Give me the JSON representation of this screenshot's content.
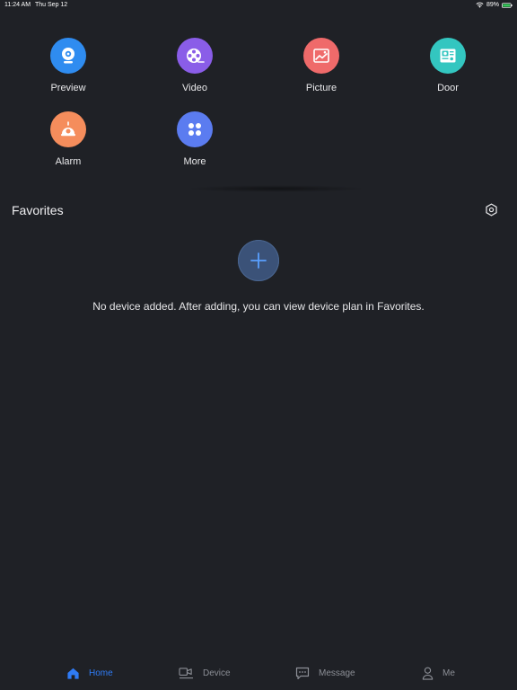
{
  "status_bar": {
    "time": "11:24 AM",
    "date": "Thu Sep 12",
    "battery": "89%"
  },
  "functions": [
    {
      "label": "Preview",
      "icon": "camera-icon",
      "color": "#2f8cf0"
    },
    {
      "label": "Video",
      "icon": "film-reel-icon",
      "color": "#8a5de8"
    },
    {
      "label": "Picture",
      "icon": "image-icon",
      "color": "#ef6a6a"
    },
    {
      "label": "Door",
      "icon": "door-station-icon",
      "color": "#33c6c0"
    },
    {
      "label": "Alarm",
      "icon": "alarm-icon",
      "color": "#f58d5c"
    },
    {
      "label": "More",
      "icon": "grid-icon",
      "color": "#5b7cf0"
    }
  ],
  "favorites": {
    "title": "Favorites",
    "empty_message": "No device added. After adding, you can view device plan in Favorites."
  },
  "nav": {
    "home": "Home",
    "device": "Device",
    "message": "Message",
    "me": "Me"
  },
  "colors": {
    "background": "#1f2126",
    "accent": "#2f7bf5",
    "inactive": "#8c8f96"
  }
}
